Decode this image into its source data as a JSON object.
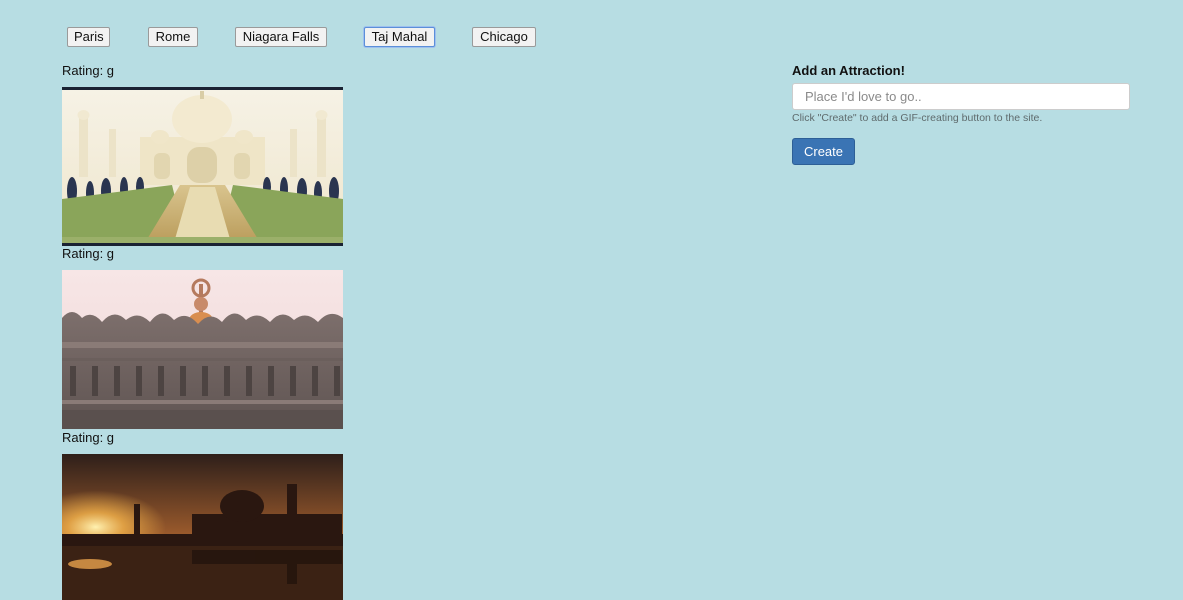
{
  "topics": {
    "buttons": [
      {
        "label": "Paris"
      },
      {
        "label": "Rome"
      },
      {
        "label": "Niagara Falls"
      },
      {
        "label": "Taj Mahal"
      },
      {
        "label": "Chicago"
      }
    ],
    "selected": "Taj Mahal"
  },
  "results": {
    "items": [
      {
        "rating": "Rating: g",
        "image": "taj-mahal-garden-gif"
      },
      {
        "rating": "Rating: g",
        "image": "taj-mahal-wall-closeup-gif"
      },
      {
        "rating": "Rating: g",
        "image": "taj-mahal-sunset-gif"
      }
    ]
  },
  "form": {
    "title": "Add an Attraction!",
    "input_placeholder": "Place I'd love to go..",
    "input_value": "",
    "help_text": "Click \"Create\" to add a GIF-creating button to the site.",
    "submit_label": "Create"
  },
  "colors": {
    "background": "#b7dde3",
    "primary_button": "#3a74b4",
    "focus_ring": "#5b8fd9"
  }
}
